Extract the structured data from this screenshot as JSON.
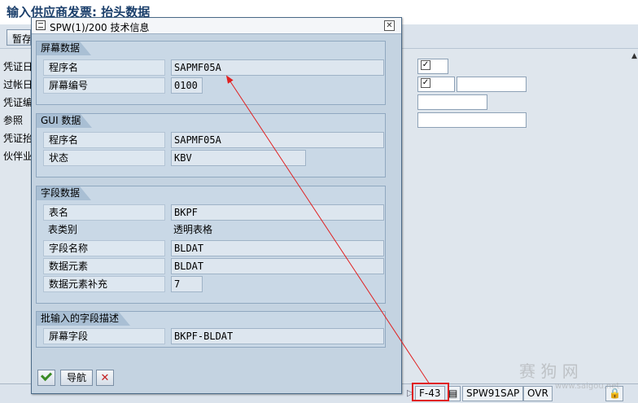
{
  "background": {
    "title": "输入供应商发票: 抬头数据",
    "toolbar_button": "暂存",
    "field_labels": [
      "凭证日期",
      "过帐日期",
      "凭证编号",
      "参照",
      "凭证抬头文本",
      "伙伴业务范围"
    ]
  },
  "popup": {
    "title": "SPW(1)/200 技术信息",
    "groups": [
      {
        "heading": "屏幕数据",
        "rows": [
          {
            "label": "程序名",
            "value": "SAPMF05A"
          },
          {
            "label": "屏幕编号",
            "value": "0100"
          }
        ]
      },
      {
        "heading": "GUI 数据",
        "rows": [
          {
            "label": "程序名",
            "value": "SAPMF05A"
          },
          {
            "label": "状态",
            "value": "KBV"
          }
        ]
      },
      {
        "heading": "字段数据",
        "rows": [
          {
            "label": "表名",
            "value": "BKPF"
          },
          {
            "label": "表类别",
            "value": "透明表格"
          },
          {
            "label": "字段名称",
            "value": "BLDAT"
          },
          {
            "label": "数据元素",
            "value": "BLDAT"
          },
          {
            "label": "数据元素补充",
            "value": "7"
          }
        ]
      },
      {
        "heading": "批输入的字段描述",
        "rows": [
          {
            "label": "屏幕字段",
            "value": "BKPF-BLDAT"
          }
        ]
      }
    ],
    "footer": {
      "confirm_icon": "check-icon",
      "nav_label": "导航",
      "cancel_icon": "cancel-icon"
    }
  },
  "statusbar": {
    "transaction": "F-43",
    "system": "SPW91SAP",
    "mode": "OVR"
  },
  "watermark": {
    "text": "赛 狗 网",
    "url": "www.saigou.net"
  },
  "annotation": {
    "highlight_color": "#e02020"
  }
}
